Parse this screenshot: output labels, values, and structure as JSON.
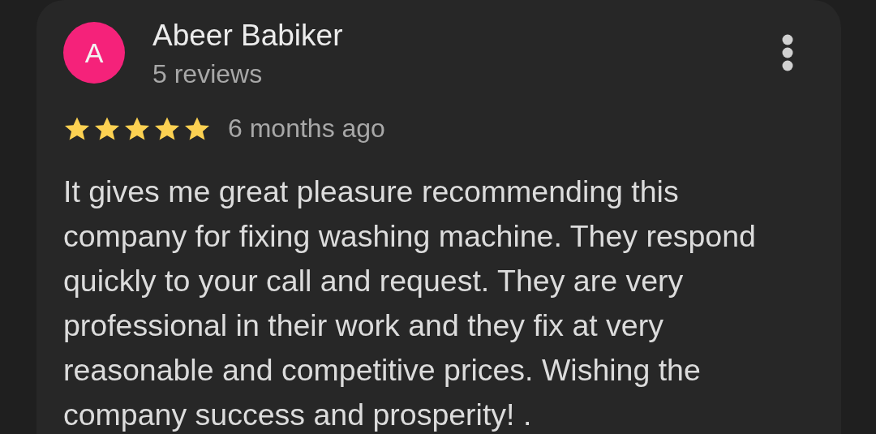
{
  "review": {
    "avatar_initial": "A",
    "author": "Abeer Babiker",
    "review_count": "5 reviews",
    "stars": 5,
    "time": "6 months ago",
    "text_lines": [
      "It gives me great pleasure recommending this",
      "company for fixing washing machine. They respond",
      "quickly to your call and request. They are very",
      "professional in their work and they fix at very",
      "reasonable and competitive prices. Wishing the",
      "company success and prosperity! ."
    ]
  }
}
